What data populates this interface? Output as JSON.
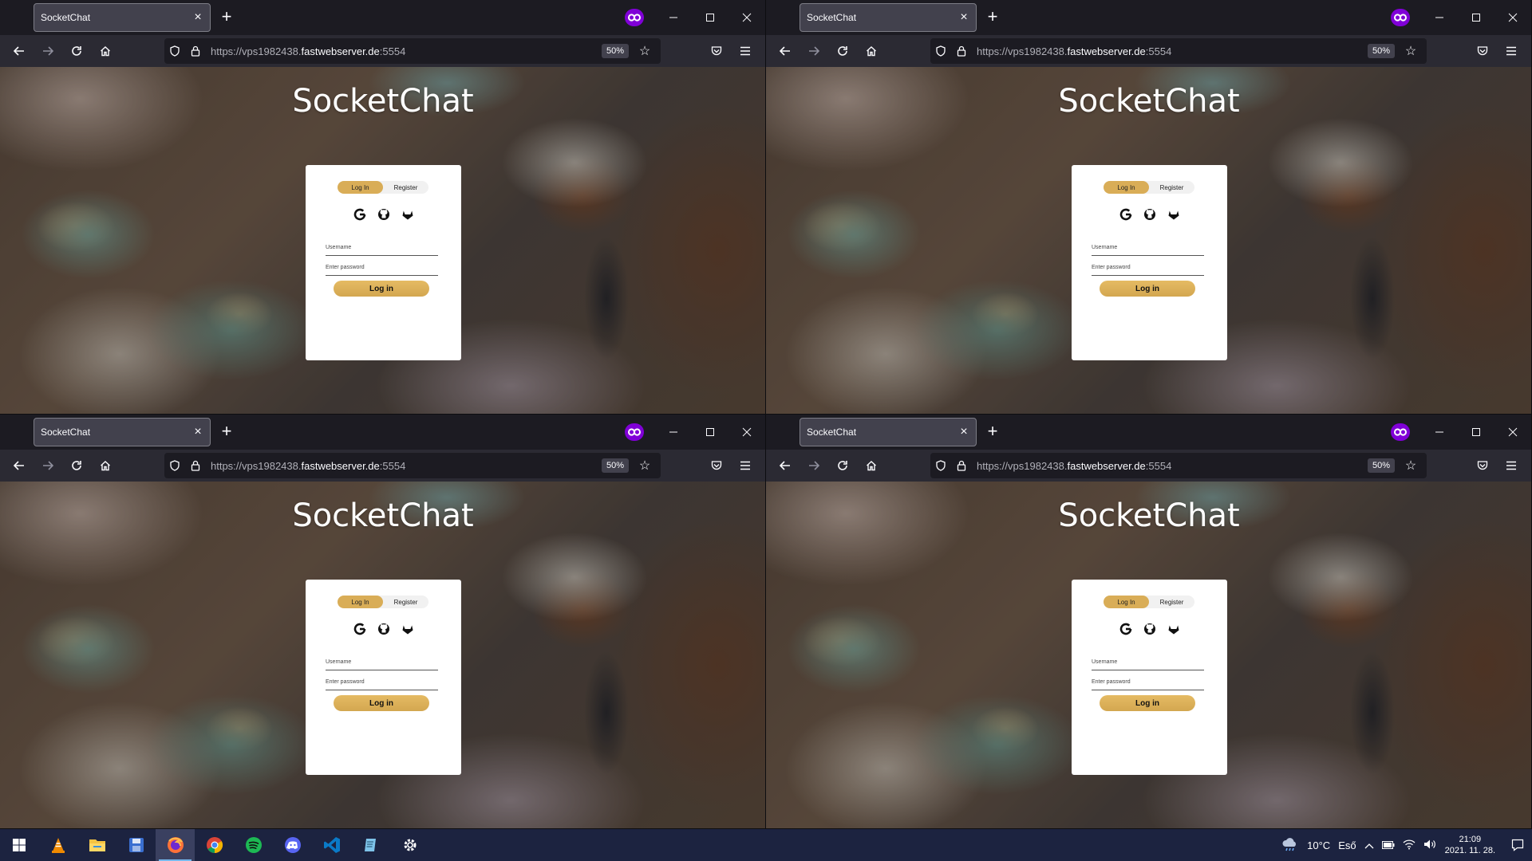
{
  "browser": {
    "tab_title": "SocketChat",
    "tab_close": "×",
    "new_tab": "+",
    "url_prefix": "https://vps1982438.",
    "url_domain": "fastwebserver.de",
    "url_suffix": ":5554",
    "zoom": "50%"
  },
  "page": {
    "app_title": "SocketChat",
    "tab_login": "Log In",
    "tab_register": "Register",
    "username_placeholder": "Username",
    "password_placeholder": "Enter password",
    "login_button": "Log in",
    "oauth_icons": [
      "google-icon",
      "github-icon",
      "gitlab-icon"
    ]
  },
  "taskbar": {
    "apps": [
      "vlc-icon",
      "file-explorer-icon",
      "save-icon",
      "firefox-icon",
      "chrome-icon",
      "spotify-icon",
      "discord-icon",
      "vscode-icon",
      "notepad-icon",
      "settings-icon"
    ],
    "active_app": "firefox-icon",
    "weather": "10°C",
    "weather_text": "Eső",
    "time": "21:09",
    "date": "2021. 11. 28."
  },
  "colors": {
    "accent_gold": "#d9ad57",
    "private_purple": "#8000d7",
    "taskbar_bg": "#1c2340"
  }
}
